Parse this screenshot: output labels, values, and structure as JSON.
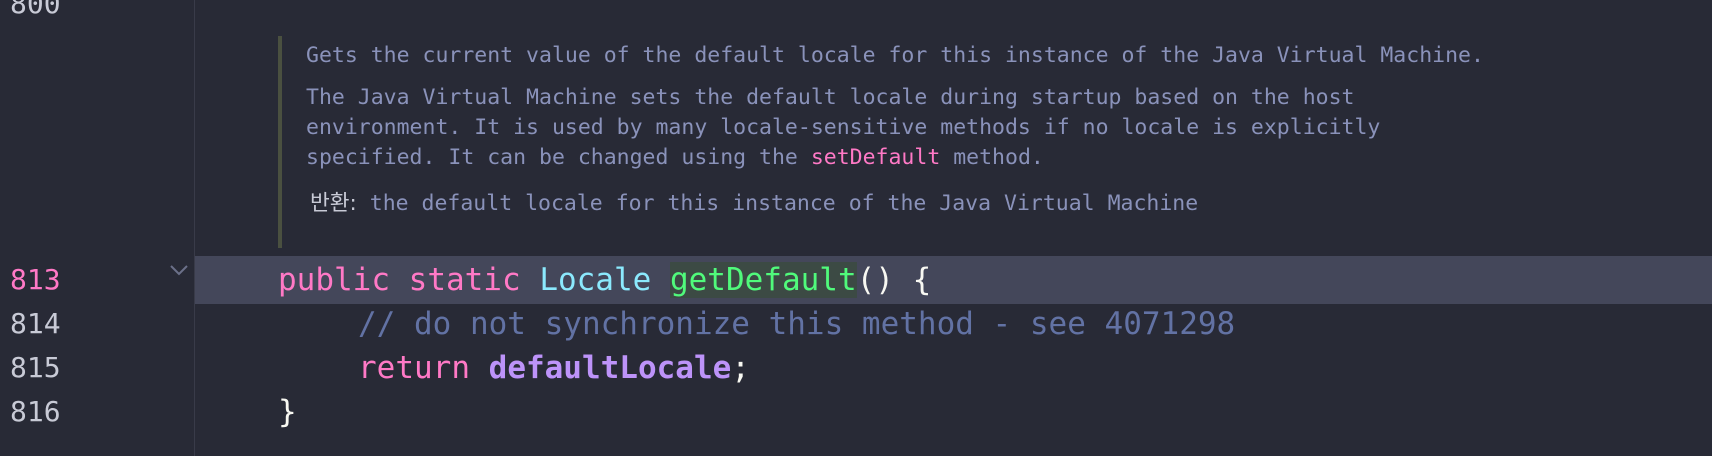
{
  "editor": {
    "gutter": {
      "lines": [
        "800",
        "813",
        "814",
        "815",
        "816"
      ],
      "active_line": "813"
    },
    "doc_popup": {
      "summary": "Gets the current value of the default locale for this instance of the Java Virtual Machine.",
      "desc_line1": "The Java Virtual Machine sets the default locale during startup based on the host",
      "desc_line2": "environment. It is used by many locale-sensitive methods if no locale is explicitly",
      "desc_line3_pre": "specified. It can be changed using the ",
      "desc_link": "setDefault",
      "desc_line3_post": " method.",
      "returns_label": "반환:",
      "returns_text": " the default locale for this instance of the Java Virtual Machine"
    },
    "code": {
      "l813_kw1": "public",
      "l813_kw2": "static",
      "l813_type": "Locale",
      "l813_fn": "getDefault",
      "l813_rest": "() {",
      "l814_comment": "// do not synchronize this method - see 4071298",
      "l815_kw": "return",
      "l815_var": "defaultLocale",
      "l815_end": ";",
      "l816": "}"
    },
    "colors": {
      "background": "#282a36",
      "current_line": "#44475a",
      "keyword": "#ff79c6",
      "type": "#8be9fd",
      "function": "#50fa7b",
      "comment": "#6272a4",
      "field": "#bd93f9"
    }
  }
}
